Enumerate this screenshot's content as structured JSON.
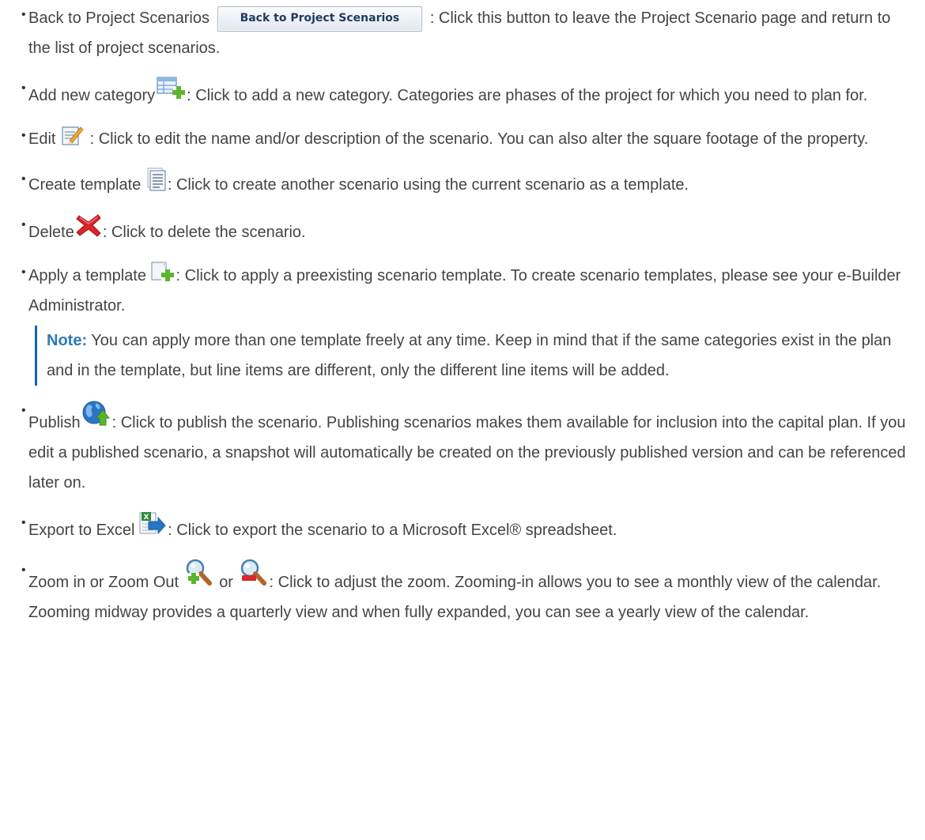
{
  "items": [
    {
      "label": "Back to Project Scenarios",
      "button_label": "Back to Project Scenarios",
      "text": ": Click this button to leave the Project Scen­ario page and return to the list of project scenarios."
    },
    {
      "label": "Add new category",
      "icon": "add-category-icon",
      "text": ": Click to add a new category. Categories are phases of the project for which you need to plan for."
    },
    {
      "label": "Edit",
      "icon": "edit-icon",
      "text": ": Click to edit the name and/or description of the scenario. You can also alter the square footage of the property."
    },
    {
      "label": "Create template",
      "icon": "document-icon",
      "text": ": Click to create another scenario using the current scenario as a template."
    },
    {
      "label": "Delete",
      "icon": "delete-x-icon",
      "text": ": Click to delete the scenario."
    },
    {
      "label": "Apply a template",
      "icon": "apply-template-icon",
      "text": ": Click to apply a preexisting scenario template. To create scenario templates, please see your e-Builder Administrator."
    },
    {
      "label": "Publish",
      "icon": "publish-globe-icon",
      "text": ": Click to publish the scenario. Publishing scenarios makes them available for inclusion into the capital plan. If you edit a published scenario, a snapshot will automatically be created on the previously published version and can be referenced later on."
    },
    {
      "label": "Export to Excel",
      "icon": "excel-export-icon",
      "text": ": Click to export the scenario to a Microsoft Excel® spreadsheet."
    },
    {
      "label": "Zoom in or Zoom Out",
      "icon": "zoom-in-icon",
      "or_word": "or",
      "icon2": "zoom-out-icon",
      "text": ": Click to adjust the zoom. Zooming-in allows you to see a monthly view of the calendar. Zooming midway provides a quarterly view and when fully expanded, you can see a yearly view of the calendar."
    }
  ],
  "note": {
    "label": "Note:",
    "text": " You can apply more than one template freely at any time. Keep in mind that if the same cat­egories exist in the plan and in the template, but line items are different, only the different line items will be added."
  },
  "colors": {
    "body_text": "#444444",
    "note_label": "#2d79b7",
    "note_border": "#1466a8",
    "delete_red": "#d9262b",
    "add_green": "#5cb531",
    "globe_blue": "#2a74c4"
  }
}
